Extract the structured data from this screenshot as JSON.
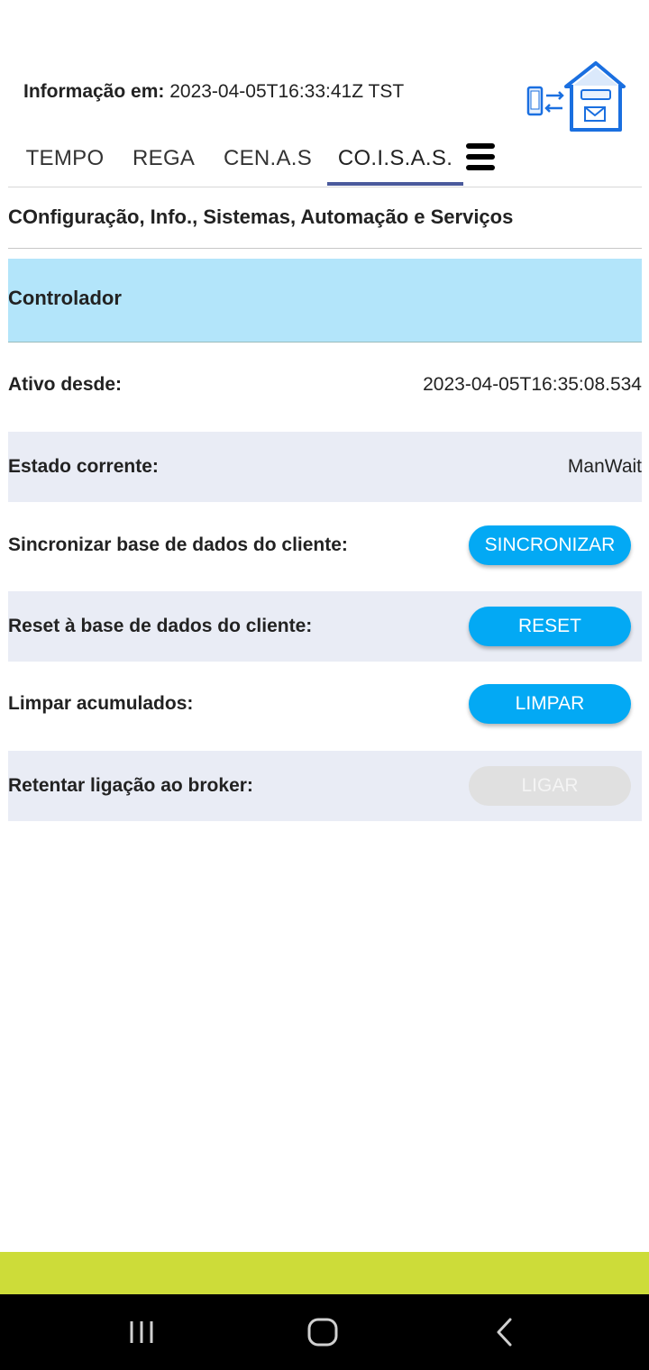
{
  "header": {
    "info_label": "Informação em:",
    "info_value": "2023-04-05T16:33:41Z TST",
    "logo_icon": "house-sync-icon"
  },
  "tabs": [
    {
      "label": "TEMPO",
      "active": false
    },
    {
      "label": "REGA",
      "active": false
    },
    {
      "label": "CEN.A.S",
      "active": false
    },
    {
      "label": "CO.I.S.A.S.",
      "active": true
    }
  ],
  "menu_icon": "hamburger-menu-icon",
  "subtitle": "COnfiguração, Info., Sistemas, Automação e Serviços",
  "section": {
    "title": "Controlador",
    "color": "#b3e5fa"
  },
  "rows": [
    {
      "label": "Ativo desde:",
      "value": "2023-04-05T16:35:08.534"
    },
    {
      "label": "Estado corrente:",
      "value": "ManWait"
    },
    {
      "label": "Sincronizar base de dados do cliente:",
      "button": "SINCRONIZAR"
    },
    {
      "label": "Reset à base de dados do cliente:",
      "button": "RESET"
    },
    {
      "label": "Limpar acumulados:",
      "button": "LIMPAR"
    },
    {
      "label": "Retentar ligação ao broker:",
      "button": "LIGAR",
      "disabled": true
    }
  ],
  "colors": {
    "accent": "#03a9f4",
    "tab_indicator": "#4a5a9c",
    "footer": "#cddc39",
    "row_alt": "#e9ecf5"
  },
  "navbar": {
    "recent_icon": "recent-apps-icon",
    "home_icon": "home-icon",
    "back_icon": "back-icon"
  }
}
